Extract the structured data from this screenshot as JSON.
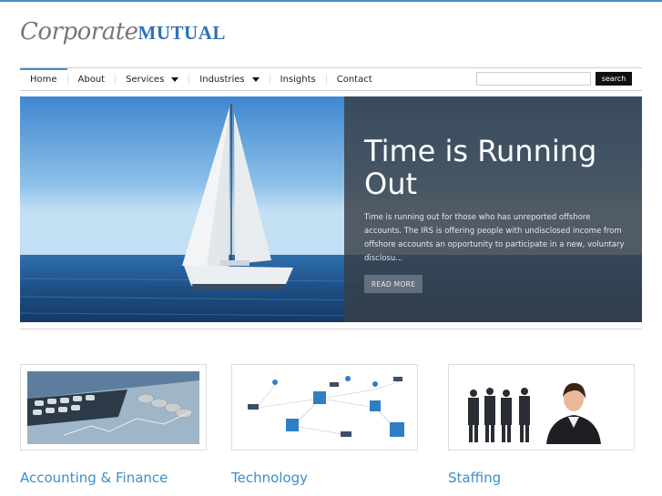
{
  "logo": {
    "script": "Corporate",
    "brand": "MUTUAL"
  },
  "nav": {
    "items": [
      {
        "label": "Home",
        "active": true,
        "dropdown": false
      },
      {
        "label": "About",
        "active": false,
        "dropdown": false
      },
      {
        "label": "Services",
        "active": false,
        "dropdown": true
      },
      {
        "label": "Industries",
        "active": false,
        "dropdown": true
      },
      {
        "label": "Insights",
        "active": false,
        "dropdown": false
      },
      {
        "label": "Contact",
        "active": false,
        "dropdown": false
      }
    ],
    "search": {
      "value": "",
      "button_label": "search"
    }
  },
  "hero": {
    "title": "Time is Running Out",
    "text": "Time is running out for those who has unreported offshore accounts. The IRS is offering people with undisclosed income from offshore accounts an opportunity to participate in a new, voluntary disclosu...",
    "button_label": "READ MORE"
  },
  "cards": [
    {
      "title": "Accounting & Finance",
      "image": "calculator-coins-image"
    },
    {
      "title": "Technology",
      "image": "network-computers-image"
    },
    {
      "title": "Staffing",
      "image": "business-people-image"
    }
  ],
  "colors": {
    "accent": "#3a8fc9",
    "brand": "#2f72b6",
    "topline": "#4a8fc7",
    "search_button": "#111111"
  }
}
